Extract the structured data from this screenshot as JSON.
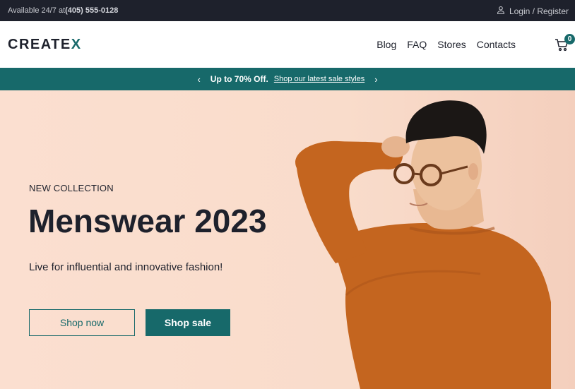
{
  "topbar": {
    "availability_prefix": "Available 24/7 at",
    "phone": "(405) 555-0128",
    "login_label": "Login / Register"
  },
  "header": {
    "logo_text": "CREATE",
    "logo_x": "X",
    "nav": [
      {
        "label": "Blog"
      },
      {
        "label": "FAQ"
      },
      {
        "label": "Stores"
      },
      {
        "label": "Contacts"
      }
    ],
    "cart_count": "0"
  },
  "promo": {
    "prev_arrow": "‹",
    "next_arrow": "›",
    "headline": "Up to 70% Off.",
    "link": "Shop our latest sale styles"
  },
  "hero": {
    "eyebrow": "NEW COLLECTION",
    "title": "Menswear 2023",
    "subtitle": "Live for influential and innovative fashion!",
    "primary_button": "Shop now",
    "secondary_button": "Shop sale"
  },
  "colors": {
    "dark": "#1e212c",
    "accent": "#17696a",
    "hero_bg": "#f9dccc",
    "sweater": "#c4651f"
  },
  "icons": {
    "user": "user-icon",
    "cart": "cart-icon",
    "prev": "chevron-left-icon",
    "next": "chevron-right-icon"
  }
}
